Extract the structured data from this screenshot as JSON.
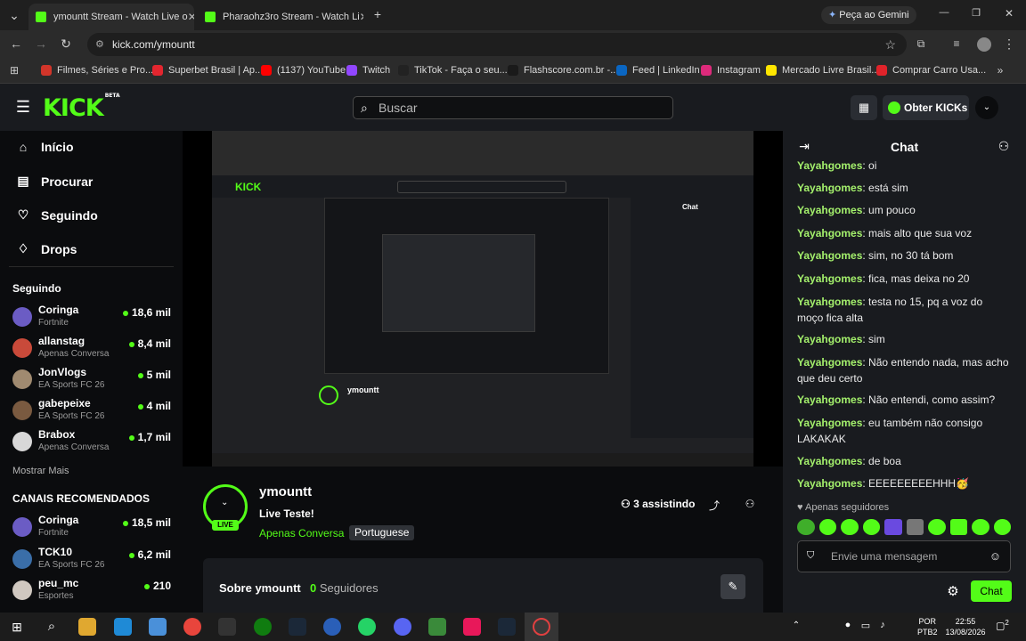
{
  "browser": {
    "tabs": [
      {
        "title": "ymountt Stream - Watch Live o",
        "active": true
      },
      {
        "title": "Pharaohz3ro Stream - Watch Li",
        "active": false
      }
    ],
    "new_tab": "+",
    "gemini_label": "Peça ao Gemini",
    "url": "kick.com/ymountt",
    "bookmarks": [
      {
        "label": "Filmes, Séries e Pro...",
        "color": "#d2352a"
      },
      {
        "label": "Superbet Brasil | Ap...",
        "color": "#e3262f"
      },
      {
        "label": "(1137) YouTube",
        "color": "#ff0000"
      },
      {
        "label": "Twitch",
        "color": "#9146ff"
      },
      {
        "label": "TikTok - Faça o seu...",
        "color": "#222222"
      },
      {
        "label": "Flashscore.com.br -...",
        "color": "#1a1a1a"
      },
      {
        "label": "Feed | LinkedIn",
        "color": "#0a66c2"
      },
      {
        "label": "Instagram",
        "color": "#dd2a7b"
      },
      {
        "label": "Mercado Livre Brasil...",
        "color": "#ffe600"
      },
      {
        "label": "Comprar Carro Usa...",
        "color": "#e0232a"
      }
    ]
  },
  "kick": {
    "logo": "KICK",
    "logo_tag": "BETA",
    "search_placeholder": "Buscar",
    "get_kicks": "Obter KICKs",
    "accent": "#53fc18"
  },
  "sidebar": {
    "nav": [
      {
        "label": "Início",
        "icon": "home-icon"
      },
      {
        "label": "Procurar",
        "icon": "browse-icon"
      },
      {
        "label": "Seguindo",
        "icon": "heart-icon"
      },
      {
        "label": "Drops",
        "icon": "drop-icon"
      }
    ],
    "following_title": "Seguindo",
    "following": [
      {
        "name": "Coringa",
        "game": "Fortnite",
        "viewers": "18,6 mil"
      },
      {
        "name": "allanstag",
        "game": "Apenas Conversa",
        "viewers": "8,4 mil"
      },
      {
        "name": "JonVlogs",
        "game": "EA Sports FC 26",
        "viewers": "5 mil"
      },
      {
        "name": "gabepeixe",
        "game": "EA Sports FC 26",
        "viewers": "4 mil"
      },
      {
        "name": "Brabox",
        "game": "Apenas Conversa",
        "viewers": "1,7 mil"
      }
    ],
    "show_more": "Mostrar Mais",
    "recommended_title": "CANAIS RECOMENDADOS",
    "recommended": [
      {
        "name": "Coringa",
        "game": "Fortnite",
        "viewers": "18,5 mil"
      },
      {
        "name": "TCK10",
        "game": "EA Sports FC 26",
        "viewers": "6,2 mil"
      },
      {
        "name": "peu_mc",
        "game": "Esportes",
        "viewers": "210"
      }
    ]
  },
  "stream": {
    "channel": "ymountt",
    "title": "Live Teste!",
    "category": "Apenas Conversa",
    "language": "Portuguese",
    "live_badge": "LIVE",
    "viewers": "3 assistindo",
    "about": "Sobre ymountt",
    "followers_count": "0",
    "followers_label": "Seguidores"
  },
  "chat": {
    "title": "Chat",
    "messages": [
      {
        "user": "Yayahgomes",
        "text": "oi"
      },
      {
        "user": "Yayahgomes",
        "text": "está sim"
      },
      {
        "user": "Yayahgomes",
        "text": "um pouco"
      },
      {
        "user": "Yayahgomes",
        "text": "mais alto que sua voz"
      },
      {
        "user": "Yayahgomes",
        "text": "sim, no 30 tá bom"
      },
      {
        "user": "Yayahgomes",
        "text": "fica, mas deixa no 20"
      },
      {
        "user": "Yayahgomes",
        "text": "testa no 15, pq a voz do moço fica alta"
      },
      {
        "user": "Yayahgomes",
        "text": "sim"
      },
      {
        "user": "Yayahgomes",
        "text": "Não entendo nada, mas acho que deu certo"
      },
      {
        "user": "Yayahgomes",
        "text": "Não entendi, como assim?"
      },
      {
        "user": "Yayahgomes",
        "text": "eu também não consigo LAKAKAK"
      },
      {
        "user": "Yayahgomes",
        "text": "de boa"
      },
      {
        "user": "Yayahgomes",
        "text": "EEEEEEEEEHHH🥳"
      }
    ],
    "followers_only": "Apenas seguidores",
    "input_placeholder": "Envie uma mensagem",
    "send_label": "Chat"
  },
  "taskbar": {
    "lang": "POR",
    "layout": "PTB2",
    "time": "22:55",
    "date": "13/08/2026",
    "notifications": "2"
  }
}
